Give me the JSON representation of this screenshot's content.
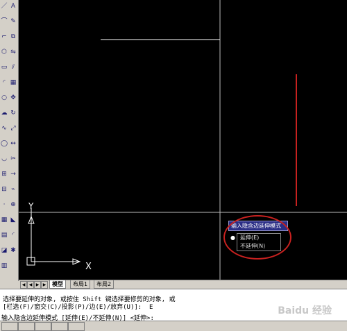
{
  "toolbar_icons_left": [
    "line-icon",
    "polyline-icon",
    "pline-icon",
    "polygon-icon",
    "rectangle-icon",
    "arc-icon",
    "circle-icon",
    "revcloud-icon",
    "spline-icon",
    "ellipse-icon",
    "ellipse-arc-icon",
    "insert-block-icon",
    "make-block-icon",
    "point-icon",
    "hatch-icon",
    "gradient-icon",
    "region-icon",
    "table-icon",
    "mtext-icon",
    "erase-icon",
    "copy-icon",
    "mirror-icon",
    "offset-icon",
    "array-icon",
    "move-icon",
    "rotate-icon",
    "scale-icon",
    "stretch-icon",
    "trim-icon",
    "extend-icon",
    "break-icon",
    "join-icon",
    "chamfer-icon",
    "fillet-icon",
    "explode-icon"
  ],
  "layout_tabs": [
    {
      "label": "模型",
      "active": true
    },
    {
      "label": "布局1",
      "active": false
    },
    {
      "label": "布局2",
      "active": false
    }
  ],
  "command": {
    "line1": "选择要延伸的对象, 或按住 Shift 键选择要修剪的对象, 或",
    "line2": "[栏选(F)/窗交(C)/投影(P)/边(E)/放弃(U)]:  E",
    "line3": "输入隐含边延伸模式 [延伸(E)/不延伸(N)] <延伸>:"
  },
  "popup": {
    "title": "输入隐含边延伸模式",
    "options": [
      {
        "label": "延伸(E)",
        "selected": true
      },
      {
        "label": "不延伸(N)",
        "selected": false
      }
    ]
  },
  "ucs": {
    "y_label": "Y",
    "x_label": "X"
  },
  "watermark": "Baidu 经验",
  "colors": {
    "canvas": "#000000",
    "red_line": "#c8211f",
    "annotation": "#c8211f",
    "popup_title": "#2b2e86"
  }
}
